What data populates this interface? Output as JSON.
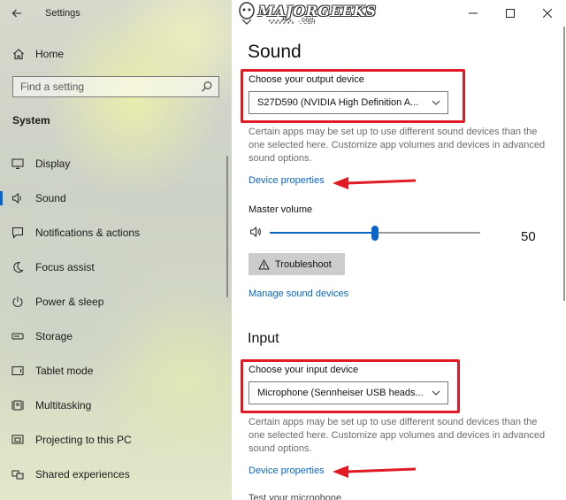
{
  "window": {
    "app_title": "Settings",
    "watermark_text": "MAJORGEEKS",
    "watermark_sub": "★★★★★★ .COM"
  },
  "sidebar": {
    "home_label": "Home",
    "search_placeholder": "Find a setting",
    "section": "System",
    "items": [
      {
        "label": "Display",
        "icon": "monitor-icon"
      },
      {
        "label": "Sound",
        "icon": "speaker-icon",
        "active": true
      },
      {
        "label": "Notifications & actions",
        "icon": "notification-icon"
      },
      {
        "label": "Focus assist",
        "icon": "moon-icon"
      },
      {
        "label": "Power & sleep",
        "icon": "power-icon"
      },
      {
        "label": "Storage",
        "icon": "storage-icon"
      },
      {
        "label": "Tablet mode",
        "icon": "tablet-icon"
      },
      {
        "label": "Multitasking",
        "icon": "multitasking-icon"
      },
      {
        "label": "Projecting to this PC",
        "icon": "projecting-icon"
      },
      {
        "label": "Shared experiences",
        "icon": "shared-icon"
      }
    ]
  },
  "sound": {
    "title": "Sound",
    "output_label": "Choose your output device",
    "output_value": "S27D590 (NVIDIA High Definition A...",
    "output_desc": "Certain apps may be set up to use different sound devices than the one selected here. Customize app volumes and devices in advanced sound options.",
    "device_properties": "Device properties",
    "master_volume_label": "Master volume",
    "master_volume_value": "50",
    "master_volume_fraction": 0.5,
    "troubleshoot_label": "Troubleshoot",
    "manage_link": "Manage sound devices"
  },
  "input": {
    "title": "Input",
    "input_label": "Choose your input device",
    "input_value": "Microphone (Sennheiser USB heads...",
    "input_desc": "Certain apps may be set up to use different sound devices than the one selected here. Customize app volumes and devices in advanced sound options.",
    "device_properties": "Device properties",
    "test_label": "Test your microphone"
  },
  "colors": {
    "accent": "#0a64c8",
    "link": "#0a66c2",
    "highlight": "#e01b24"
  }
}
